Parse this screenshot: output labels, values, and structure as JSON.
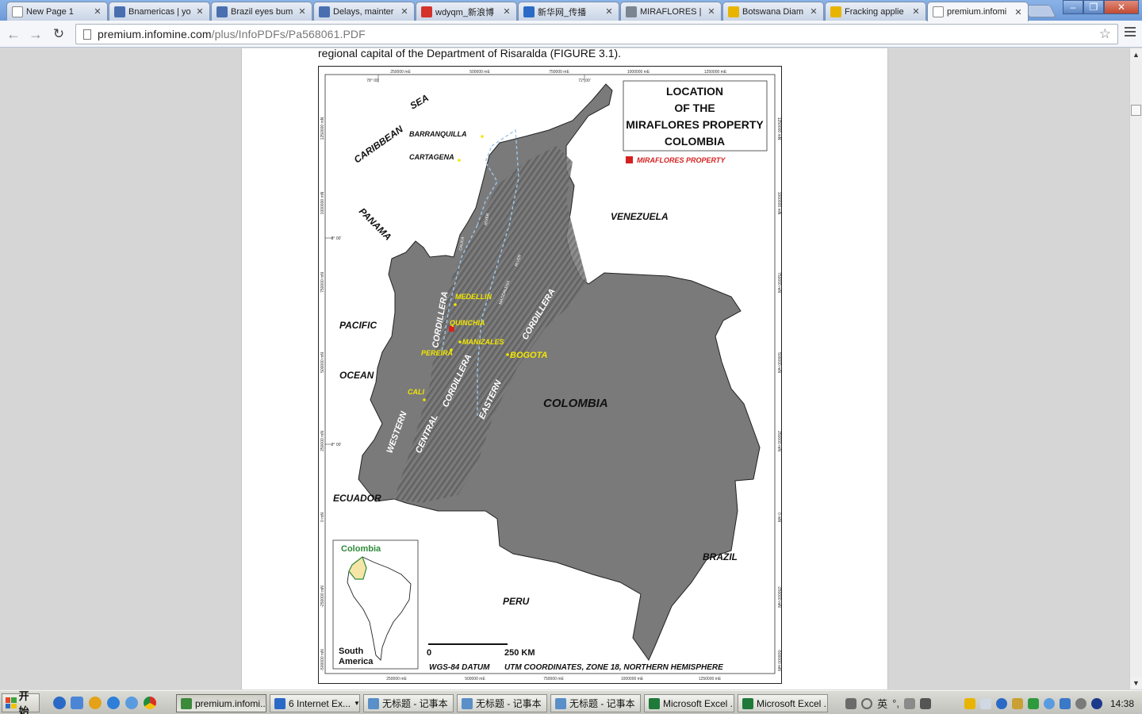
{
  "browser": {
    "tabs": [
      {
        "title": "New Page 1",
        "favicon_color": "#ffffff",
        "icon": "page-icon"
      },
      {
        "title": "Bnamericas | yo",
        "favicon_color": "#4a6fb0",
        "icon": "site-icon"
      },
      {
        "title": "Brazil eyes bum",
        "favicon_color": "#4a6fb0",
        "icon": "site-icon"
      },
      {
        "title": "Delays, mainter",
        "favicon_color": "#4a6fb0",
        "icon": "site-icon"
      },
      {
        "title": "wdyqm_新浪博",
        "favicon_color": "#d4332a",
        "icon": "sina-icon"
      },
      {
        "title": "新华网_传播",
        "favicon_color": "#2a6ac6",
        "icon": "xinhua-icon"
      },
      {
        "title": "MIRAFLORES |",
        "favicon_color": "#7a8590",
        "icon": "site-icon"
      },
      {
        "title": "Botswana Diam",
        "favicon_color": "#e8b400",
        "icon": "mining-icon"
      },
      {
        "title": "Fracking applie",
        "favicon_color": "#e8b400",
        "icon": "mining-icon"
      },
      {
        "title": "premium.infomi",
        "favicon_color": "#ffffff",
        "icon": "page-icon"
      }
    ],
    "active_tab_index": 9,
    "url_host": "premium.infomine.com",
    "url_path": "/plus/InfoPDFs/Pa568061.PDF"
  },
  "document": {
    "text_line": "regional capital of the Department of Risaralda (FIGURE 3.1)."
  },
  "map": {
    "title_lines": [
      "LOCATION",
      "OF THE",
      "MIRAFLORES PROPERTY",
      "COLOMBIA"
    ],
    "legend": "MIRAFLORES PROPERTY",
    "legend_color": "#d42020",
    "regions": [
      "CARIBBEAN",
      "SEA",
      "PANAMA",
      "PACIFIC",
      "OCEAN",
      "VENEZUELA",
      "COLOMBIA",
      "ECUADOR",
      "PERU",
      "BRAZIL"
    ],
    "cities": [
      "BARRANQUILLA",
      "CARTAGENA",
      "MEDELLIN",
      "QUINCHIA",
      "MANIZALES",
      "PEREIRA",
      "BOGOTA",
      "CALI"
    ],
    "cordilleras": [
      "WESTERN",
      "CORDILLERA",
      "CENTRAL",
      "CORDILLERA",
      "EASTERN",
      "CORDILLERA"
    ],
    "rivers": [
      "CAUCA",
      "RIVER",
      "MAGDALENA",
      "RIVER"
    ],
    "top_ticks": [
      "250000 mE",
      "500000 mE",
      "750000 mE",
      "1000000 mE",
      "1250000 mE"
    ],
    "bottom_ticks": [
      "250000 mE",
      "500000 mE",
      "750000 mE",
      "1000000 mE",
      "1250000 mE"
    ],
    "left_ticks": [
      "1250000 mN",
      "1000000 mN",
      "750000 mN",
      "500000 mN",
      "250000 mN",
      "0 mN",
      "-250000 mN",
      "-500000 mN"
    ],
    "right_ticks": [
      "1250000 mN",
      "1000000 mN",
      "750000 mN",
      "500000 mN",
      "250000 mN",
      "0 mN",
      "-250000 mN",
      "-500000 mN"
    ],
    "lon_labels": [
      "78° 00'",
      "72° 00'"
    ],
    "lat_labels": [
      "8° 00'",
      "2° 00'"
    ],
    "scale_start": "0",
    "scale_end": "250 KM",
    "datum": "WGS-84 DATUM",
    "coords": "UTM COORDINATES, ZONE 18, NORTHERN HEMISPHERE",
    "inset_title": "Colombia",
    "inset_subtitle_lines": [
      "South",
      "America"
    ],
    "land_color": "#7a7a7a",
    "city_color": "#f2e600"
  },
  "taskbar": {
    "start_label": "开始",
    "tasks": [
      {
        "label": "premium.infomi...",
        "icon_color": "#3b8a3b",
        "active": true
      },
      {
        "label": "6 Internet Ex...",
        "icon_color": "#2a6ac6",
        "active": false,
        "has_dropdown": true
      },
      {
        "label": "无标题 - 记事本",
        "icon_color": "#5a8fc8",
        "active": false
      },
      {
        "label": "无标题 - 记事本",
        "icon_color": "#5a8fc8",
        "active": false
      },
      {
        "label": "无标题 - 记事本",
        "icon_color": "#5a8fc8",
        "active": false
      },
      {
        "label": "Microsoft Excel ...",
        "icon_color": "#1f7a3a",
        "active": false
      },
      {
        "label": "Microsoft Excel ...",
        "icon_color": "#1f7a3a",
        "active": false
      }
    ],
    "ime_label": "英",
    "clock": "14:38"
  }
}
